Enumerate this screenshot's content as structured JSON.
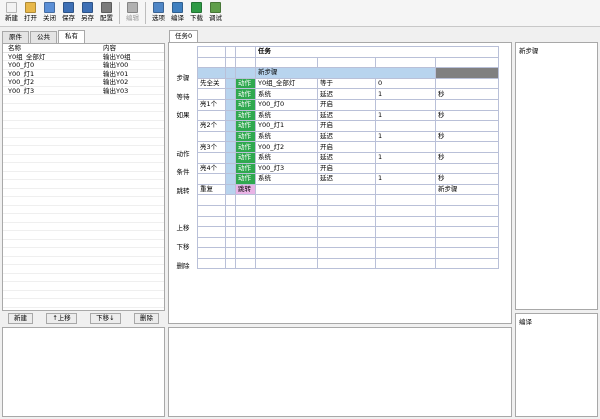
{
  "toolbar": {
    "buttons": [
      {
        "label": "新建",
        "icon": "new-file-icon",
        "color": "#f2f2f2"
      },
      {
        "label": "打开",
        "icon": "open-folder-icon",
        "color": "#e8b84a"
      },
      {
        "label": "关闭",
        "icon": "close-file-icon",
        "color": "#5b8fd6"
      },
      {
        "label": "保存",
        "icon": "save-disk-icon",
        "color": "#3d6fb5"
      },
      {
        "label": "另存",
        "icon": "save-as-icon",
        "color": "#3d6fb5"
      },
      {
        "label": "配置",
        "icon": "wrench-icon",
        "color": "#7a7a7a"
      },
      {
        "label": "编辑",
        "icon": "edit-icon",
        "color": "#b0b0b0",
        "disabled": true
      },
      {
        "label": "选项",
        "icon": "options-icon",
        "color": "#4f86c6"
      },
      {
        "label": "编译",
        "icon": "compile-icon",
        "color": "#3f7fbf"
      },
      {
        "label": "下载",
        "icon": "download-icon",
        "color": "#2e9a45"
      },
      {
        "label": "调试",
        "icon": "debug-icon",
        "color": "#5f9e4a"
      }
    ]
  },
  "left_panel": {
    "tabs": [
      "原件",
      "公共",
      "私有"
    ],
    "active_tab": "私有",
    "columns": [
      "名称",
      "内容"
    ],
    "rows": [
      [
        "Y0组_全部灯",
        "输出Y0组"
      ],
      [
        "Y00_灯0",
        "输出Y00"
      ],
      [
        "Y00_灯1",
        "输出Y01"
      ],
      [
        "Y00_灯2",
        "输出Y02"
      ],
      [
        "Y00_灯3",
        "输出Y03"
      ]
    ],
    "buttons": [
      "新建",
      "↑上移",
      "下移↓",
      "删除"
    ]
  },
  "middle": {
    "tab": "任务0",
    "side_buttons": [
      "步骤",
      "等待",
      "如果",
      "动作",
      "条件",
      "跳转",
      "上移",
      "下移",
      "删除"
    ],
    "header": "任务",
    "step_label": "新步骤",
    "rows": [
      {
        "name": "先全关",
        "type": "动作",
        "target": "Y0组_全部灯",
        "op": "等于",
        "value": "0",
        "unit": ""
      },
      {
        "name": "",
        "type": "动作",
        "target": "系统",
        "op": "延迟",
        "value": "1",
        "unit": "秒"
      },
      {
        "name": "亮1个",
        "type": "动作",
        "target": "Y00_灯0",
        "op": "开启",
        "value": "",
        "unit": ""
      },
      {
        "name": "",
        "type": "动作",
        "target": "系统",
        "op": "延迟",
        "value": "1",
        "unit": "秒"
      },
      {
        "name": "亮2个",
        "type": "动作",
        "target": "Y00_灯1",
        "op": "开启",
        "value": "",
        "unit": ""
      },
      {
        "name": "",
        "type": "动作",
        "target": "系统",
        "op": "延迟",
        "value": "1",
        "unit": "秒"
      },
      {
        "name": "亮3个",
        "type": "动作",
        "target": "Y00_灯2",
        "op": "开启",
        "value": "",
        "unit": ""
      },
      {
        "name": "",
        "type": "动作",
        "target": "系统",
        "op": "延迟",
        "value": "1",
        "unit": "秒"
      },
      {
        "name": "亮4个",
        "type": "动作",
        "target": "Y00_灯3",
        "op": "开启",
        "value": "",
        "unit": ""
      },
      {
        "name": "",
        "type": "动作",
        "target": "系统",
        "op": "延迟",
        "value": "1",
        "unit": "秒"
      },
      {
        "name": "重复",
        "type": "跳转",
        "target": "",
        "op": "",
        "value": "",
        "unit": "新步骤"
      }
    ]
  },
  "right_top": {
    "title": "新步骤"
  },
  "right_bottom": {
    "title": "编译"
  }
}
